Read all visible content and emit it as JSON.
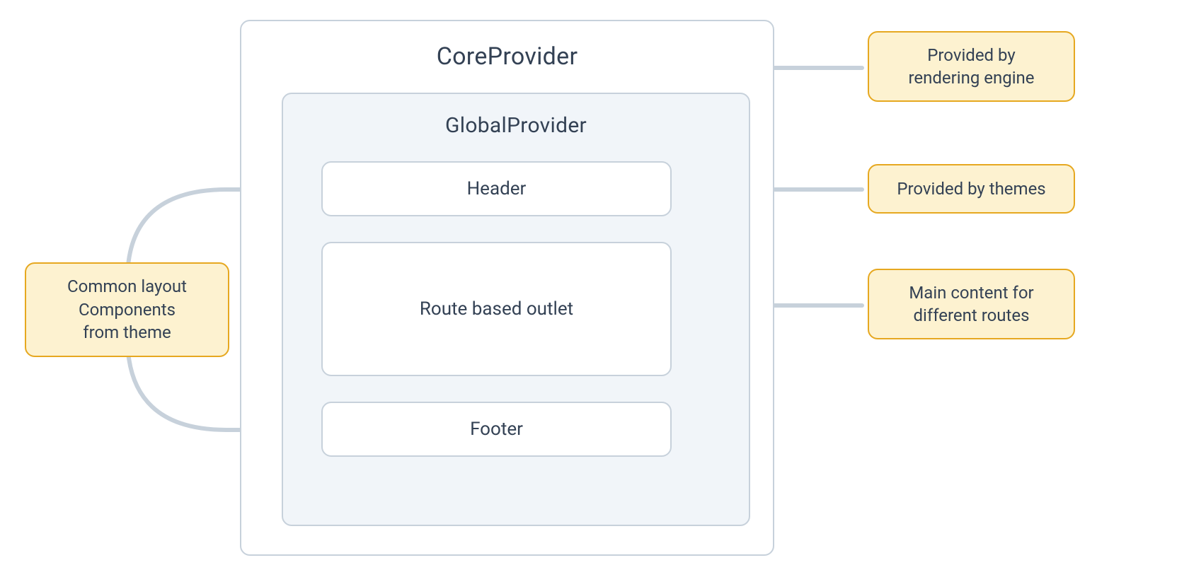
{
  "core": {
    "title": "CoreProvider"
  },
  "global": {
    "title": "GlobalProvider"
  },
  "header": {
    "label": "Header"
  },
  "outlet": {
    "label": "Route based outlet"
  },
  "footer": {
    "label": "Footer"
  },
  "notes": {
    "common": {
      "line1": "Common layout",
      "line2": "Components",
      "line3": "from theme"
    },
    "rendering": {
      "line1": "Provided by",
      "line2": "rendering engine"
    },
    "themes": {
      "line1": "Provided by themes"
    },
    "routes": {
      "line1": "Main content for",
      "line2": "different routes"
    }
  },
  "colors": {
    "border": "#c7d1db",
    "tintBg": "#f1f5f9",
    "text": "#334154",
    "noteBorder": "#e6a820",
    "noteBg": "#fdf2d0"
  }
}
